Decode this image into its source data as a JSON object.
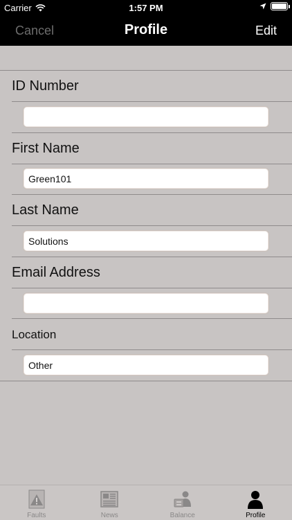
{
  "status_bar": {
    "carrier": "Carrier",
    "time": "1:57 PM"
  },
  "nav": {
    "cancel_label": "Cancel",
    "title": "Profile",
    "edit_label": "Edit"
  },
  "form": {
    "id_number": {
      "label": "ID Number",
      "value": ""
    },
    "first_name": {
      "label": "First Name",
      "value": "Green101"
    },
    "last_name": {
      "label": "Last Name",
      "value": "Solutions"
    },
    "email": {
      "label": "Email Address",
      "value": ""
    },
    "location": {
      "label": "Location",
      "value": "Other"
    }
  },
  "tabs": [
    {
      "label": "Faults",
      "icon": "warning-icon",
      "active": false
    },
    {
      "label": "News",
      "icon": "newspaper-icon",
      "active": false
    },
    {
      "label": "Balance",
      "icon": "balance-icon",
      "active": false
    },
    {
      "label": "Profile",
      "icon": "person-icon",
      "active": true
    }
  ],
  "colors": {
    "background": "#c8c4c3",
    "nav_background": "#000000",
    "tab_active": "#000000",
    "tab_inactive": "#8a8888"
  }
}
